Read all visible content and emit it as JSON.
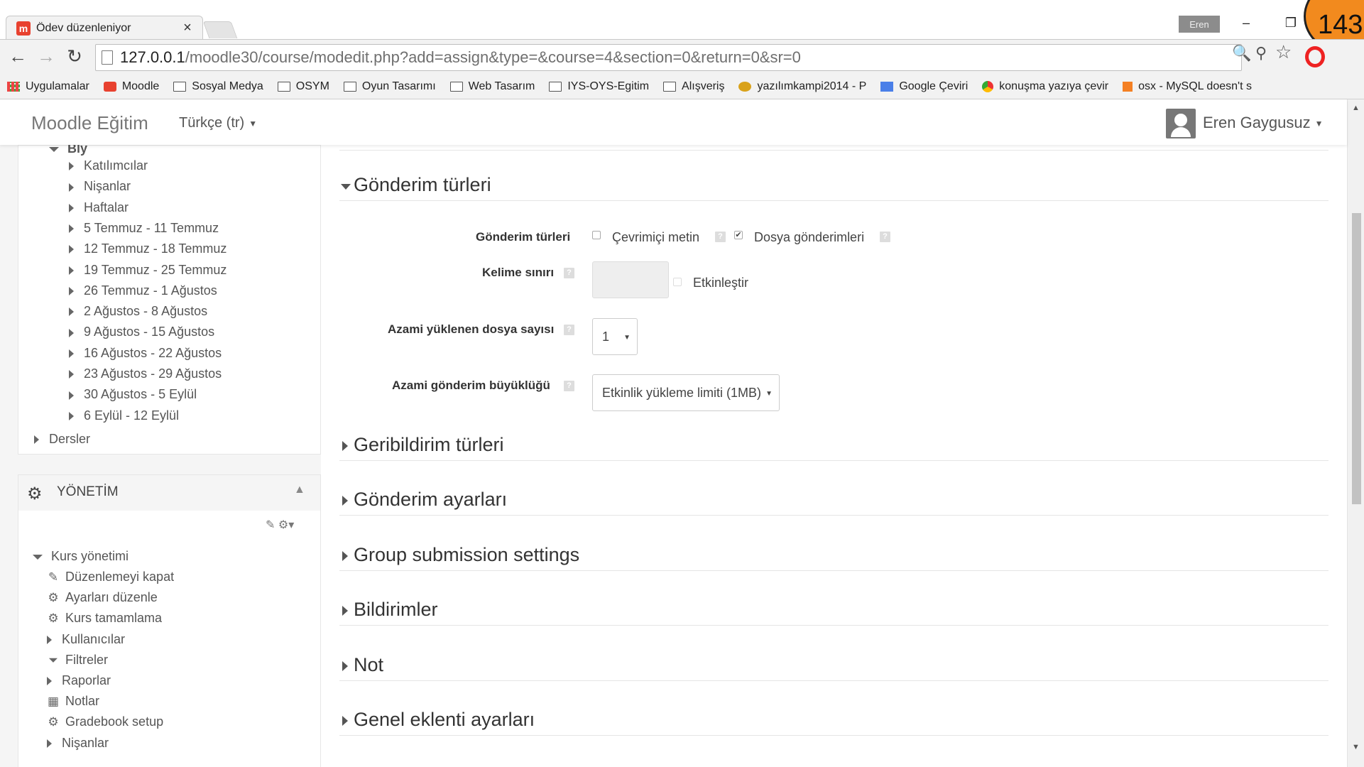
{
  "browser": {
    "tab_title": "Ödev düzenleniyor",
    "tab_close": "×",
    "tab_favicon": "m",
    "profile_name": "Eren",
    "minimize": "–",
    "restore": "❐",
    "badge_number": "143",
    "back": "←",
    "forward": "→",
    "reload": "↻",
    "url_host": "127.0.0.1",
    "url_path": "/moodle30/course/modedit.php?add=assign&type=&course=4&section=0&return=0&sr=0",
    "zoom_icon": "🔍",
    "key_icon": "⚲",
    "star_icon": "☆",
    "bookmarks": [
      {
        "label": "Uygulamalar",
        "icon": "apps-icon"
      },
      {
        "label": "Moodle",
        "icon": "moodle-icon"
      },
      {
        "label": "Sosyal Medya",
        "icon": "folder-icon"
      },
      {
        "label": "OSYM",
        "icon": "folder-icon"
      },
      {
        "label": "Oyun Tasarımı",
        "icon": "folder-icon"
      },
      {
        "label": "Web Tasarım",
        "icon": "folder-icon"
      },
      {
        "label": "IYS-OYS-Egitim",
        "icon": "folder-icon"
      },
      {
        "label": "Alışveriş",
        "icon": "folder-icon"
      },
      {
        "label": "yazılımkampi2014 - P",
        "icon": "cheetah-icon"
      },
      {
        "label": "Google Çeviri",
        "icon": "google-translate-icon"
      },
      {
        "label": "konuşma yazıya çevir",
        "icon": "chrome-icon"
      },
      {
        "label": "osx - MySQL doesn't s",
        "icon": "stackoverflow-icon"
      }
    ]
  },
  "navbar": {
    "brand": "Moodle Eğitim",
    "language": "Türkçe (tr)",
    "user": "Eren Gaygusuz"
  },
  "nav_block": {
    "parent": "Bly",
    "items": [
      "Katılımcılar",
      "Nişanlar",
      "Haftalar",
      "5 Temmuz - 11 Temmuz",
      "12 Temmuz - 18 Temmuz",
      "19 Temmuz - 25 Temmuz",
      "26 Temmuz - 1 Ağustos",
      "2 Ağustos - 8 Ağustos",
      "9 Ağustos - 15 Ağustos",
      "16 Ağustos - 22 Ağustos",
      "23 Ağustos - 29 Ağustos",
      "30 Ağustos - 5 Eylül",
      "6 Eylül - 12 Eylül"
    ],
    "dersler": "Dersler"
  },
  "admin_block": {
    "title": "YÖNETİM",
    "gears": "⚙",
    "collapse": "▲",
    "tools": "✎ ⚙▾",
    "course_admin": "Kurs yönetimi",
    "items": [
      {
        "label": "Düzenlemeyi kapat",
        "icon": "✎",
        "icon_name": "pencil-icon"
      },
      {
        "label": "Ayarları düzenle",
        "icon": "⚙",
        "icon_name": "gear-icon"
      },
      {
        "label": "Kurs tamamlama",
        "icon": "⚙",
        "icon_name": "gear-icon"
      },
      {
        "label": "Kullanıcılar",
        "icon": "",
        "icon_name": "expand-icon"
      },
      {
        "label": "Filtreler",
        "icon": "⏷",
        "icon_name": "filter-icon"
      },
      {
        "label": "Raporlar",
        "icon": "",
        "icon_name": "expand-icon"
      },
      {
        "label": "Notlar",
        "icon": "▦",
        "icon_name": "table-icon"
      },
      {
        "label": "Gradebook setup",
        "icon": "⚙",
        "icon_name": "gear-icon"
      },
      {
        "label": "Nişanlar",
        "icon": "",
        "icon_name": "expand-icon"
      }
    ]
  },
  "form": {
    "submission_types_section": "Gönderim türleri",
    "submission_types_label": "Gönderim türleri",
    "online_text": "Çevrimiçi metin",
    "online_text_checked": false,
    "file_submissions": "Dosya gönderimleri",
    "file_submissions_checked": true,
    "word_limit_label": "Kelime sınırı",
    "word_limit_value": "",
    "enable_label": "Etkinleştir",
    "max_files_label": "Azami yüklenen dosya sayısı",
    "max_files_value": "1",
    "max_size_label": "Azami gönderim büyüklüğü",
    "max_size_value": "Etkinlik yükleme limiti (1MB)",
    "help": "?",
    "check_mark": "✔",
    "select_arrow": "▼",
    "collapsed_sections": [
      "Geribildirim türleri",
      "Gönderim ayarları",
      "Group submission settings",
      "Bildirimler",
      "Not",
      "Genel eklenti ayarları"
    ]
  },
  "scrollbar": {
    "up": "▲",
    "down": "▼"
  }
}
